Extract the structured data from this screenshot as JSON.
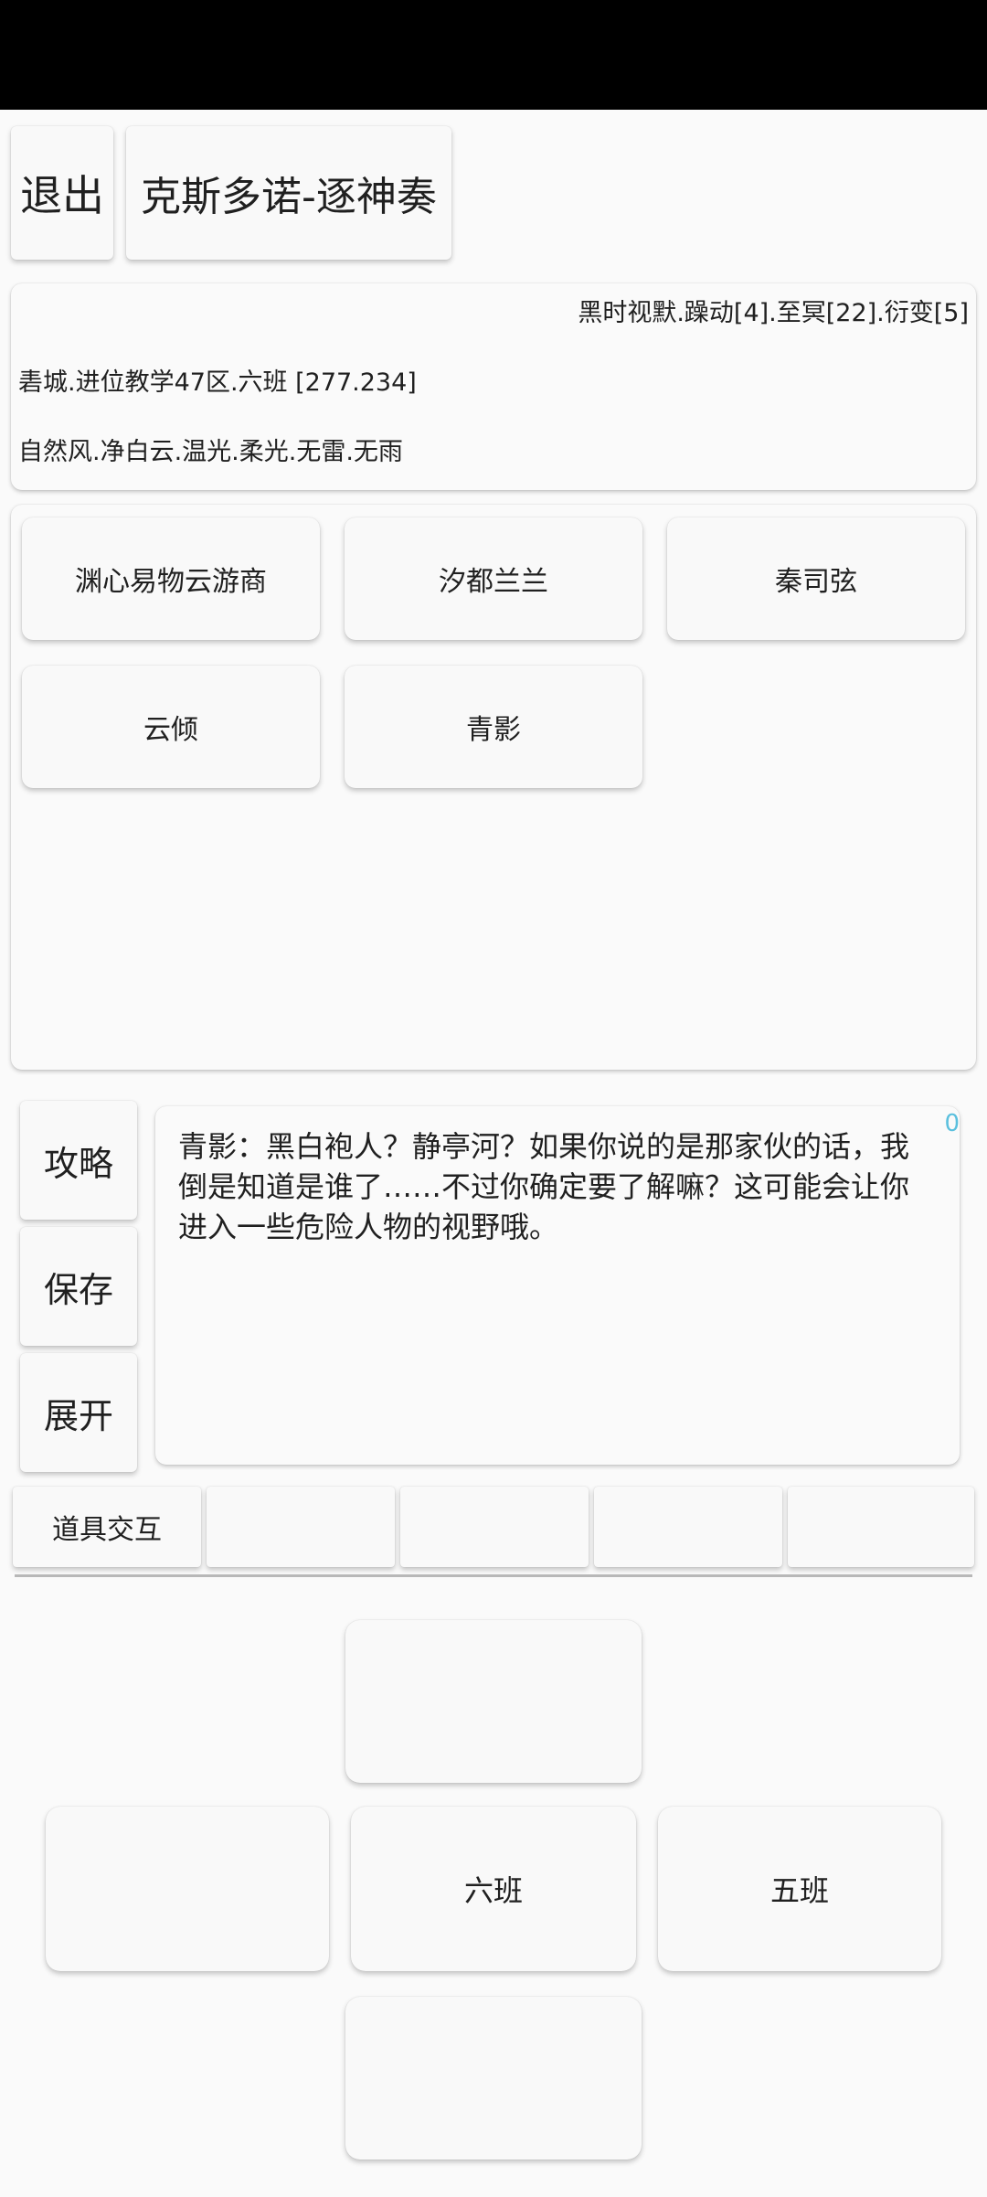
{
  "header": {
    "exit_label": "退出",
    "title": "克斯多诺-逐神奏"
  },
  "info": {
    "time_status": "黑时视默.躁动[4].至冥[22].衍变[5]",
    "location": "砉城.进位教学47区.六班 [277.234]",
    "weather": "自然风.净白云.温光.柔光.无雷.无雨"
  },
  "npcs": [
    "渊心易物云游商",
    "汐都兰兰",
    "秦司弦",
    "云倾",
    "青影"
  ],
  "side_menu": {
    "guide_label": "攻略",
    "save_label": "保存",
    "expand_label": "展开"
  },
  "dialog": {
    "text": "青影：黑白袍人？静亭河？如果你说的是那家伙的话，我倒是知道是谁了……不过你确定要了解嘛？这可能会让你进入一些危险人物的视野哦。",
    "counter": "0"
  },
  "tools": [
    "道具交互",
    "",
    "",
    "",
    ""
  ],
  "nav": {
    "north": "",
    "west": "",
    "center": "六班",
    "east": "五班",
    "south": ""
  }
}
